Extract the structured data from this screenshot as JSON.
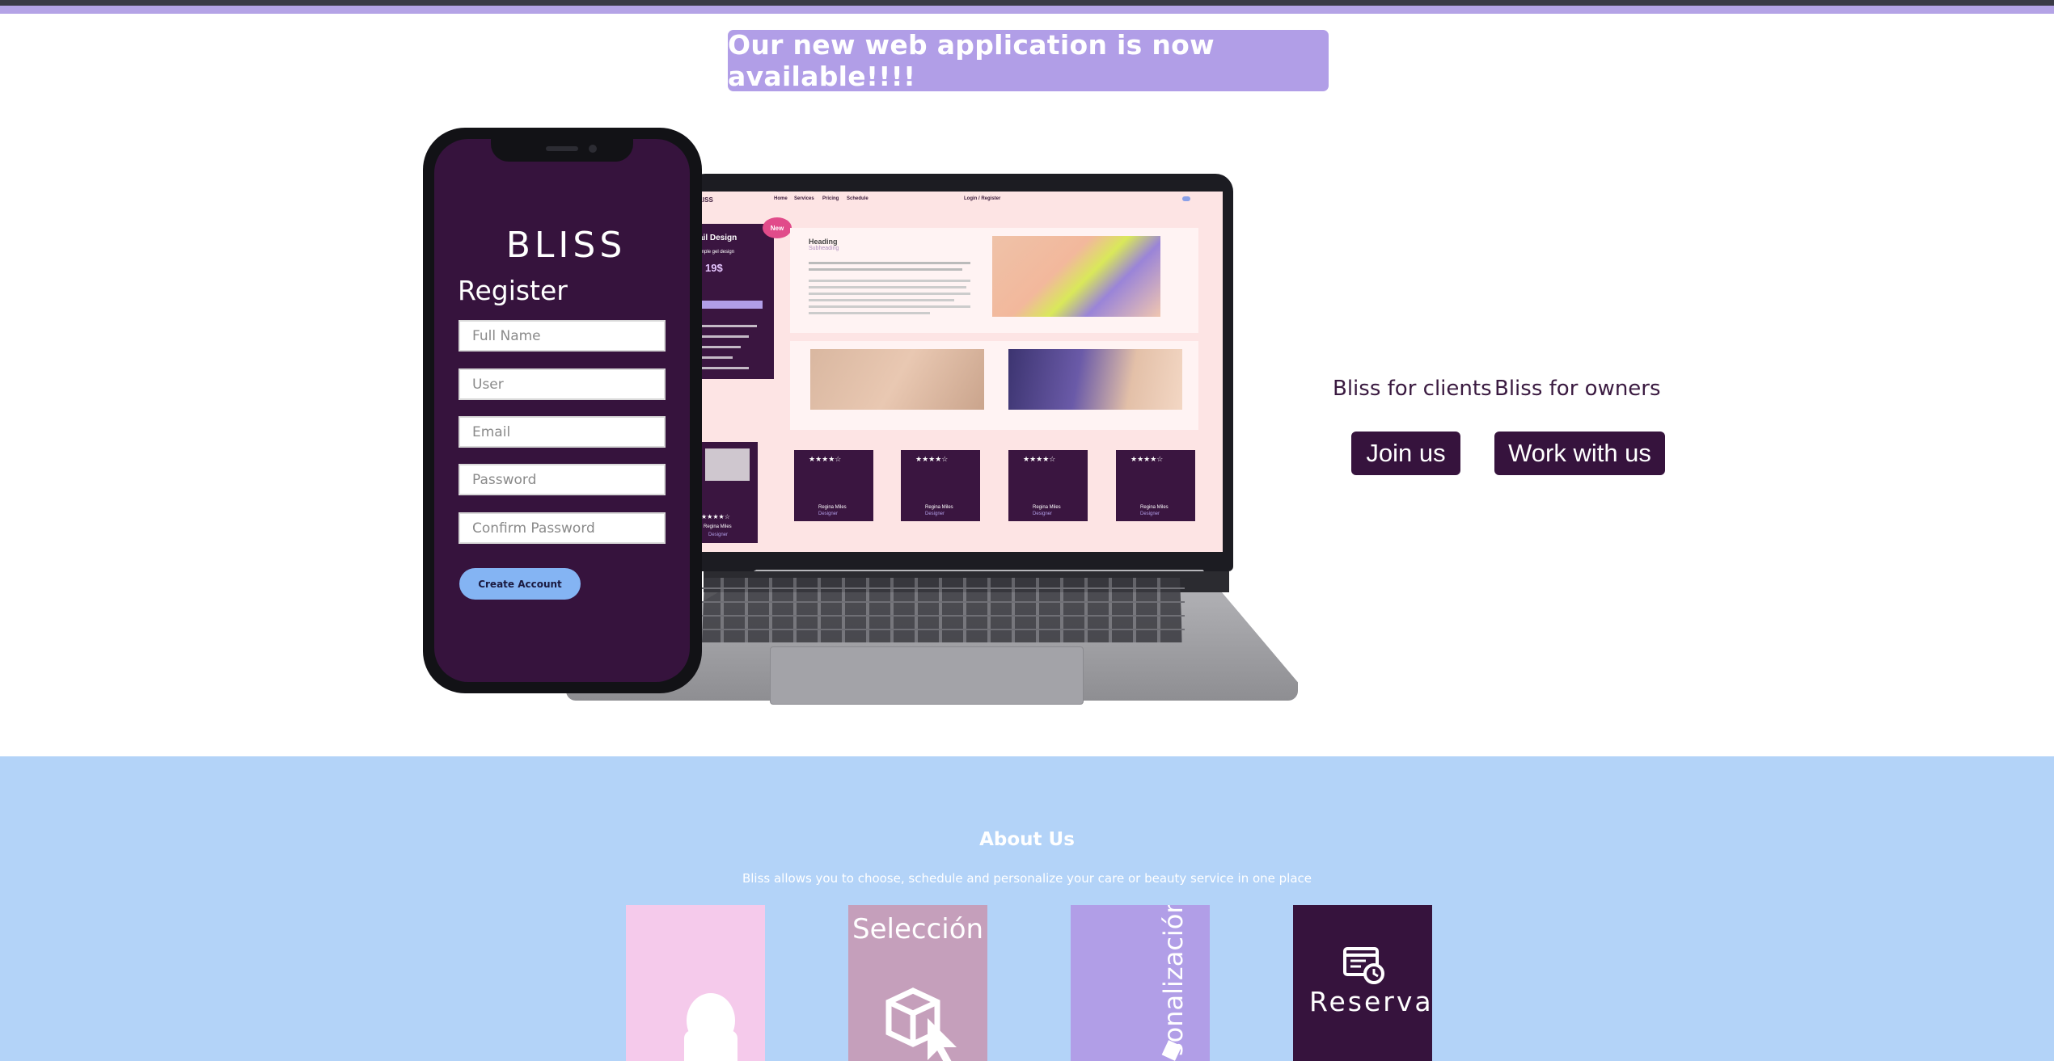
{
  "banner": {
    "text": "Our new web application is now available!!!!"
  },
  "phone": {
    "brand": "BLISS",
    "heading": "Register",
    "fields": [
      {
        "placeholder": "Full Name"
      },
      {
        "placeholder": "User"
      },
      {
        "placeholder": "Email"
      },
      {
        "placeholder": "Password"
      },
      {
        "placeholder": "Confirm Password"
      }
    ],
    "submit_label": "Create Account"
  },
  "laptop_screen": {
    "brand": "LISS",
    "nav": [
      "Home",
      "Services",
      "Pricing",
      "Schedule"
    ],
    "login": "Login / Register",
    "sidebar_title": "ail Design",
    "sidebar_sub": "mple gel design",
    "price": "19$",
    "badge": "New",
    "heading": "Heading",
    "subheading": "Subheading",
    "stars": "★★★★☆",
    "reviewer_name": "Regina Miles",
    "reviewer_role": "Designer"
  },
  "cta": {
    "clients_label": "Bliss for clients",
    "owners_label": "Bliss for owners",
    "join_label": "Join us",
    "work_label": "Work with us"
  },
  "about": {
    "title": "About Us",
    "subtitle": "Bliss allows you to choose, schedule and personalize your care or beauty service in one place",
    "tiles": [
      {
        "label": "",
        "color": "#f5caeb"
      },
      {
        "label": "Selección",
        "color": "#c59fbb"
      },
      {
        "label": "sonalización",
        "color": "#b19ee7"
      },
      {
        "label": "Reserva",
        "color": "#36133d"
      }
    ]
  },
  "colors": {
    "accent": "#b19ee7",
    "dark": "#36133d",
    "button_blue": "#84b4f3",
    "section_bg": "#b3d3f8"
  }
}
